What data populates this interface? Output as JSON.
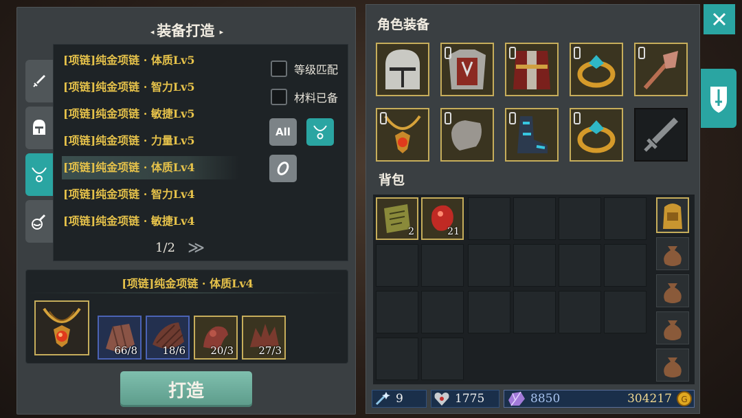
{
  "craft": {
    "title": "装备打造",
    "tabs": [
      {
        "icon": "sword-icon"
      },
      {
        "icon": "helmet-icon"
      },
      {
        "icon": "necklace-icon"
      },
      {
        "icon": "potion-icon"
      }
    ],
    "recipes": [
      "[项链]纯金项链 · 体质Lv5",
      "[项链]纯金项链 · 智力Lv5",
      "[项链]纯金项链 · 敏捷Lv5",
      "[项链]纯金项链 · 力量Lv5",
      "[项链]纯金项链 · 体质Lv4",
      "[项链]纯金项链 · 智力Lv4",
      "[项链]纯金项链 · 敏捷Lv4"
    ],
    "selected_recipe_index": 4,
    "filters": {
      "level_match": "等级匹配",
      "materials_ready": "材料已备",
      "all_label": "All"
    },
    "pager": {
      "page": "1/2",
      "next": "≫"
    },
    "target": {
      "name": "[项链]纯金项链 · 体质Lv4",
      "materials": [
        "66/8",
        "18/6",
        "20/3",
        "27/3"
      ]
    },
    "craft_button": "打造"
  },
  "equip": {
    "title": "角色装备",
    "slots": [
      "helmet",
      "chest-armor",
      "cloak",
      "ring",
      "weapon-mace",
      "necklace",
      "gloves",
      "boots",
      "ring",
      "weapon-empty"
    ]
  },
  "bag": {
    "title": "背包",
    "items": [
      {
        "icon": "scroll-icon",
        "count": "2"
      },
      {
        "icon": "red-gem-icon",
        "count": "21"
      }
    ]
  },
  "currency": {
    "wand": "9",
    "heart": "1775",
    "crystal": "8850",
    "gold": "304217"
  },
  "colors": {
    "accent": "#2aa5a2",
    "gold_text": "#e6c24a",
    "slot_border": "#c7ae5b"
  }
}
